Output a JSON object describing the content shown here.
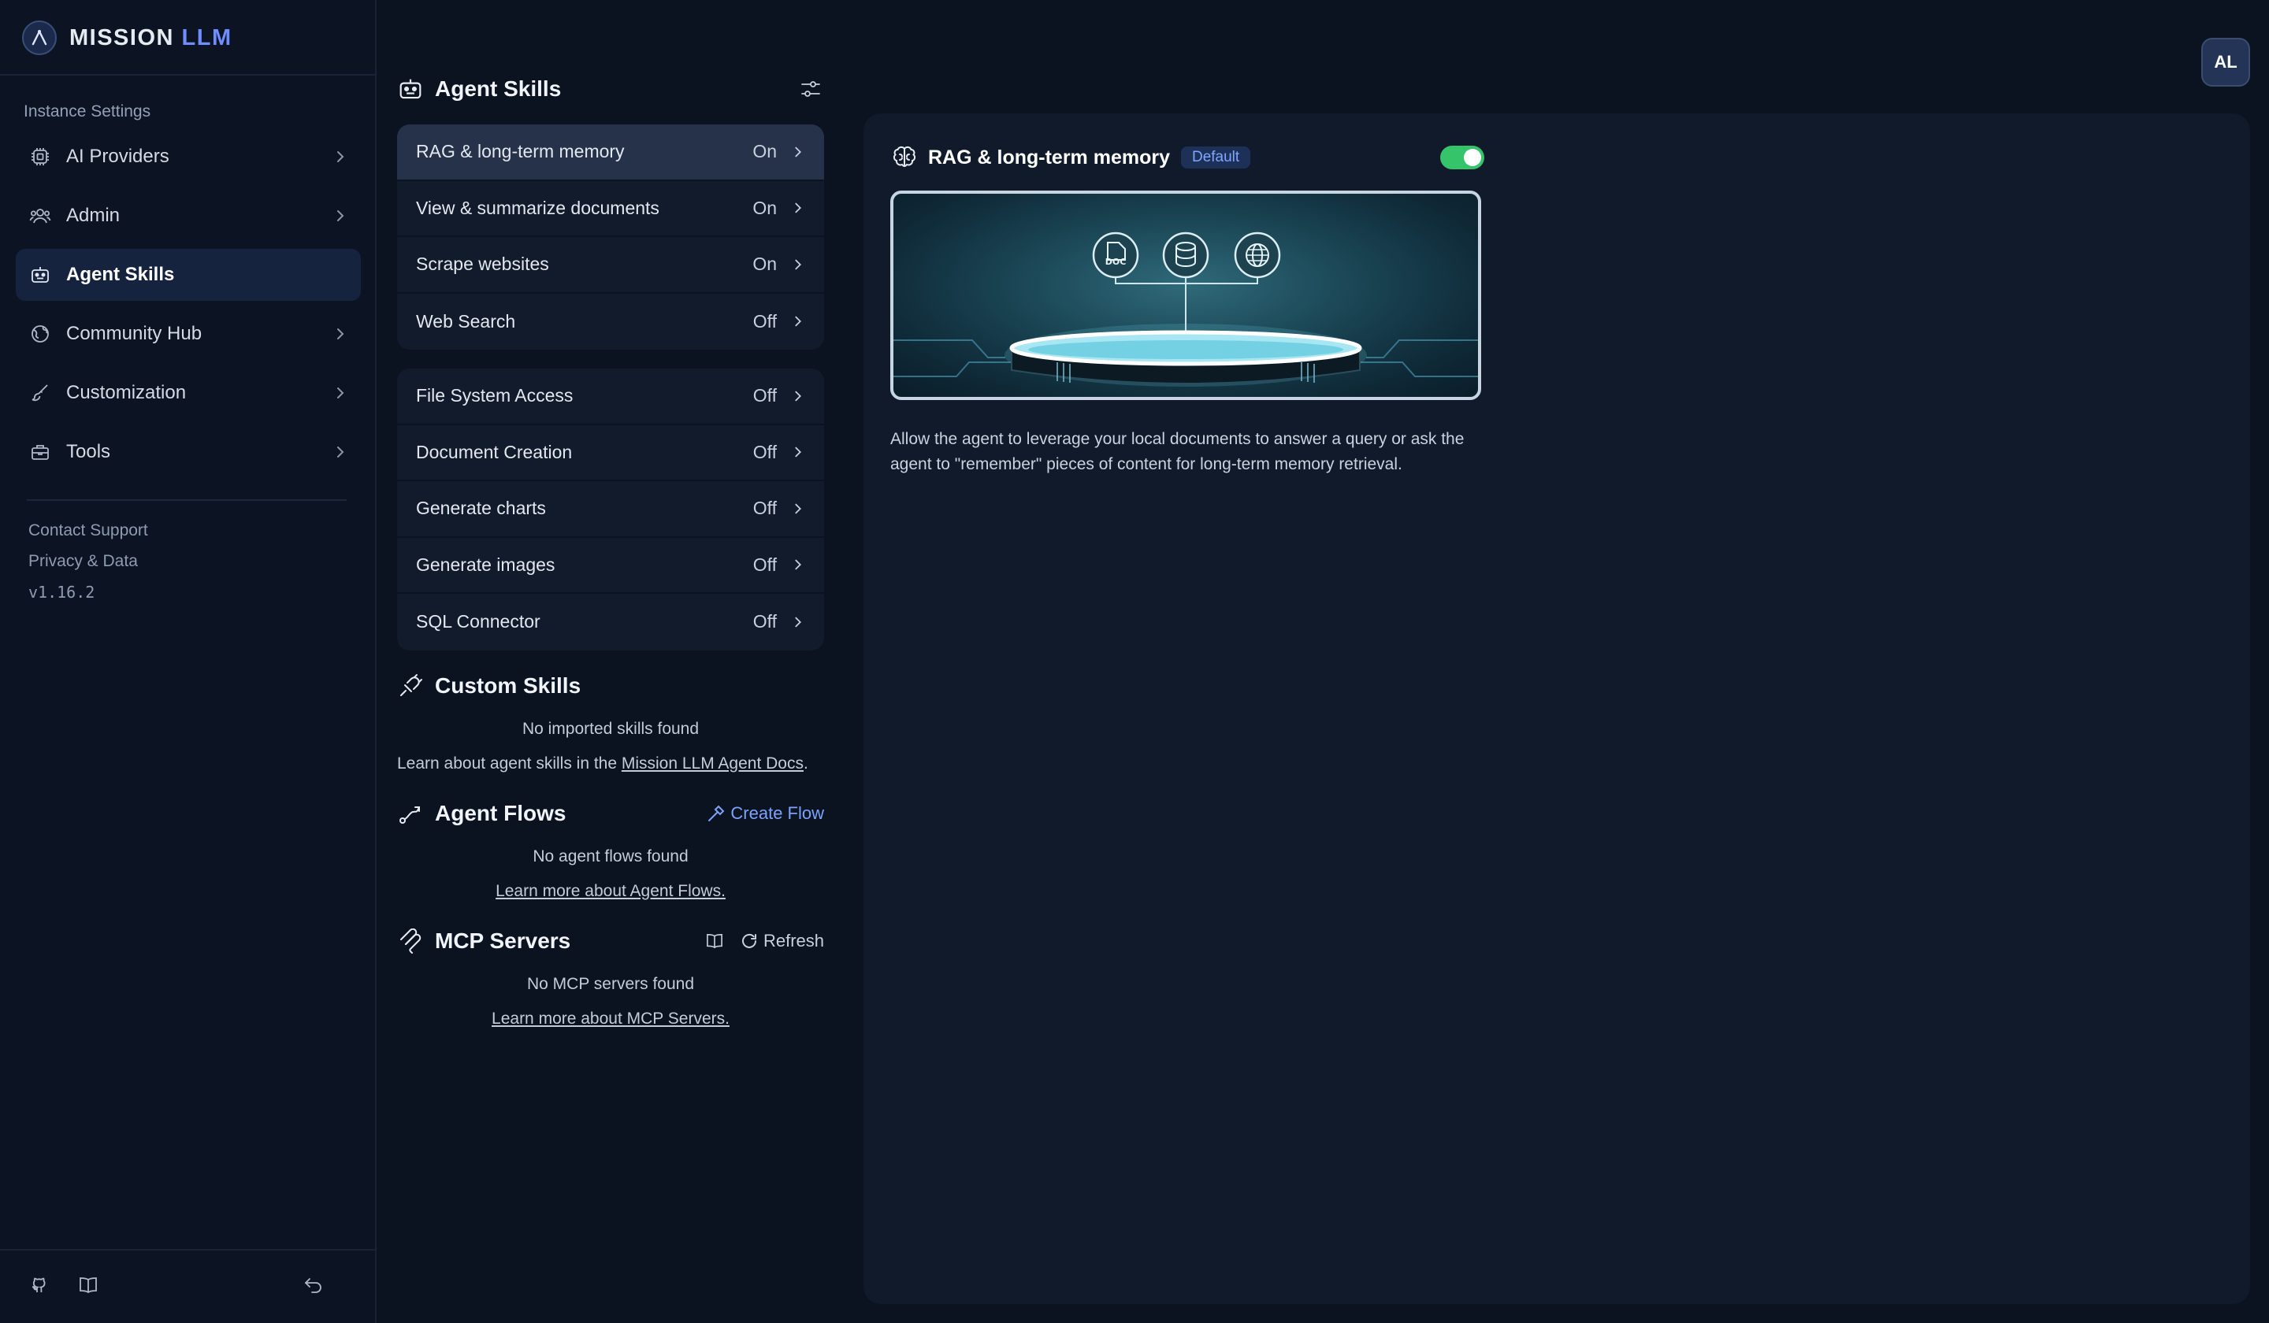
{
  "brand": {
    "name_main": "MISSION",
    "name_accent": "LLM"
  },
  "sidebar": {
    "section_label": "Instance Settings",
    "items": [
      {
        "label": "AI Providers",
        "icon": "cpu-icon",
        "active": false
      },
      {
        "label": "Admin",
        "icon": "users-icon",
        "active": false
      },
      {
        "label": "Agent Skills",
        "icon": "robot-icon",
        "active": true
      },
      {
        "label": "Community Hub",
        "icon": "globe-icon",
        "active": false
      },
      {
        "label": "Customization",
        "icon": "paintbrush-icon",
        "active": false
      },
      {
        "label": "Tools",
        "icon": "toolbox-icon",
        "active": false
      }
    ],
    "links": {
      "contact": "Contact Support",
      "privacy": "Privacy & Data",
      "version": "v1.16.2"
    },
    "footer_icons": [
      "github-icon",
      "book-icon",
      "return-icon"
    ]
  },
  "skills": {
    "title": "Agent Skills",
    "default_group": [
      {
        "name": "RAG & long-term memory",
        "state": "On"
      },
      {
        "name": "View & summarize documents",
        "state": "On"
      },
      {
        "name": "Scrape websites",
        "state": "On"
      },
      {
        "name": "Web Search",
        "state": "Off"
      }
    ],
    "configurable_group": [
      {
        "name": "File System Access",
        "state": "Off"
      },
      {
        "name": "Document Creation",
        "state": "Off"
      },
      {
        "name": "Generate charts",
        "state": "Off"
      },
      {
        "name": "Generate images",
        "state": "Off"
      },
      {
        "name": "SQL Connector",
        "state": "Off"
      }
    ]
  },
  "custom_skills": {
    "title": "Custom Skills",
    "empty": "No imported skills found",
    "learn_prefix": "Learn about agent skills in the ",
    "learn_link": "Mission LLM Agent Docs",
    "learn_suffix": "."
  },
  "agent_flows": {
    "title": "Agent Flows",
    "action": "Create Flow",
    "empty": "No agent flows found",
    "learn_link": "Learn more about Agent Flows."
  },
  "mcp_servers": {
    "title": "MCP Servers",
    "action": "Refresh",
    "empty": "No MCP servers found",
    "learn_link": "Learn more about MCP Servers."
  },
  "user": {
    "initials": "AL"
  },
  "detail": {
    "title": "RAG & long-term memory",
    "badge": "Default",
    "enabled": true,
    "hero_icons": [
      "doc-icon",
      "database-icon",
      "globe-icon"
    ],
    "hero_doc_label": "DOC",
    "description": "Allow the agent to leverage your local documents to answer a query or ask the agent to \"remember\" pieces of content for long-term memory retrieval."
  },
  "colors": {
    "accent": "#6f8dff",
    "toggle_on": "#35c46a",
    "link": "#7aa2ff",
    "background": "#0b1220"
  }
}
